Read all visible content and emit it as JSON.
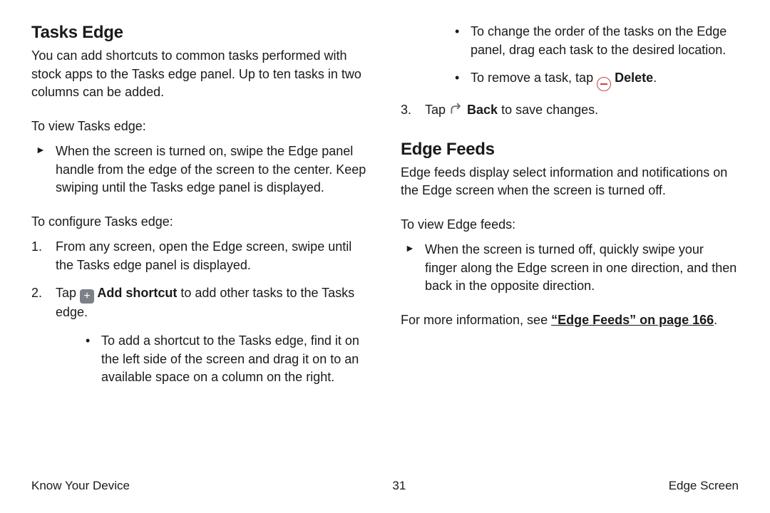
{
  "left": {
    "h1": "Tasks Edge",
    "intro": "You can add shortcuts to common tasks performed with stock apps to the Tasks edge panel. Up to ten tasks in two columns can be added.",
    "view_label": "To view Tasks edge:",
    "view_item": "When the screen is turned on, swipe the Edge panel handle from the edge of the screen to the center. Keep swiping until the Tasks edge panel is displayed.",
    "config_label": "To configure Tasks edge:",
    "step1": "From any screen, open the Edge screen, swipe until the Tasks edge panel is displayed.",
    "step2_pre": "Tap ",
    "step2_bold": " Add shortcut",
    "step2_post": " to add other tasks to the Tasks edge.",
    "sub_a": "To add a shortcut to the Tasks edge, find it on the left side of the screen and drag it on to an available space on a column on the right."
  },
  "right": {
    "sub_b": "To change the order of the tasks on the Edge panel, drag each task to the desired location.",
    "sub_c_pre": "To remove a task, tap ",
    "sub_c_bold": " Delete",
    "sub_c_post": ".",
    "step3_pre": "Tap ",
    "step3_bold": " Back",
    "step3_post": " to save changes.",
    "h2": "Edge Feeds",
    "intro": "Edge feeds display select information and notifications on the Edge screen when the screen is turned off.",
    "view_label": "To view Edge feeds:",
    "view_item": "When the screen is turned off, quickly swipe your finger along the Edge screen in one direction, and then back in the opposite direction.",
    "more_pre": "For more information, see ",
    "more_link": "“Edge Feeds” on page 166",
    "more_post": "."
  },
  "footer": {
    "left": "Know Your Device",
    "center": "31",
    "right": "Edge Screen"
  }
}
